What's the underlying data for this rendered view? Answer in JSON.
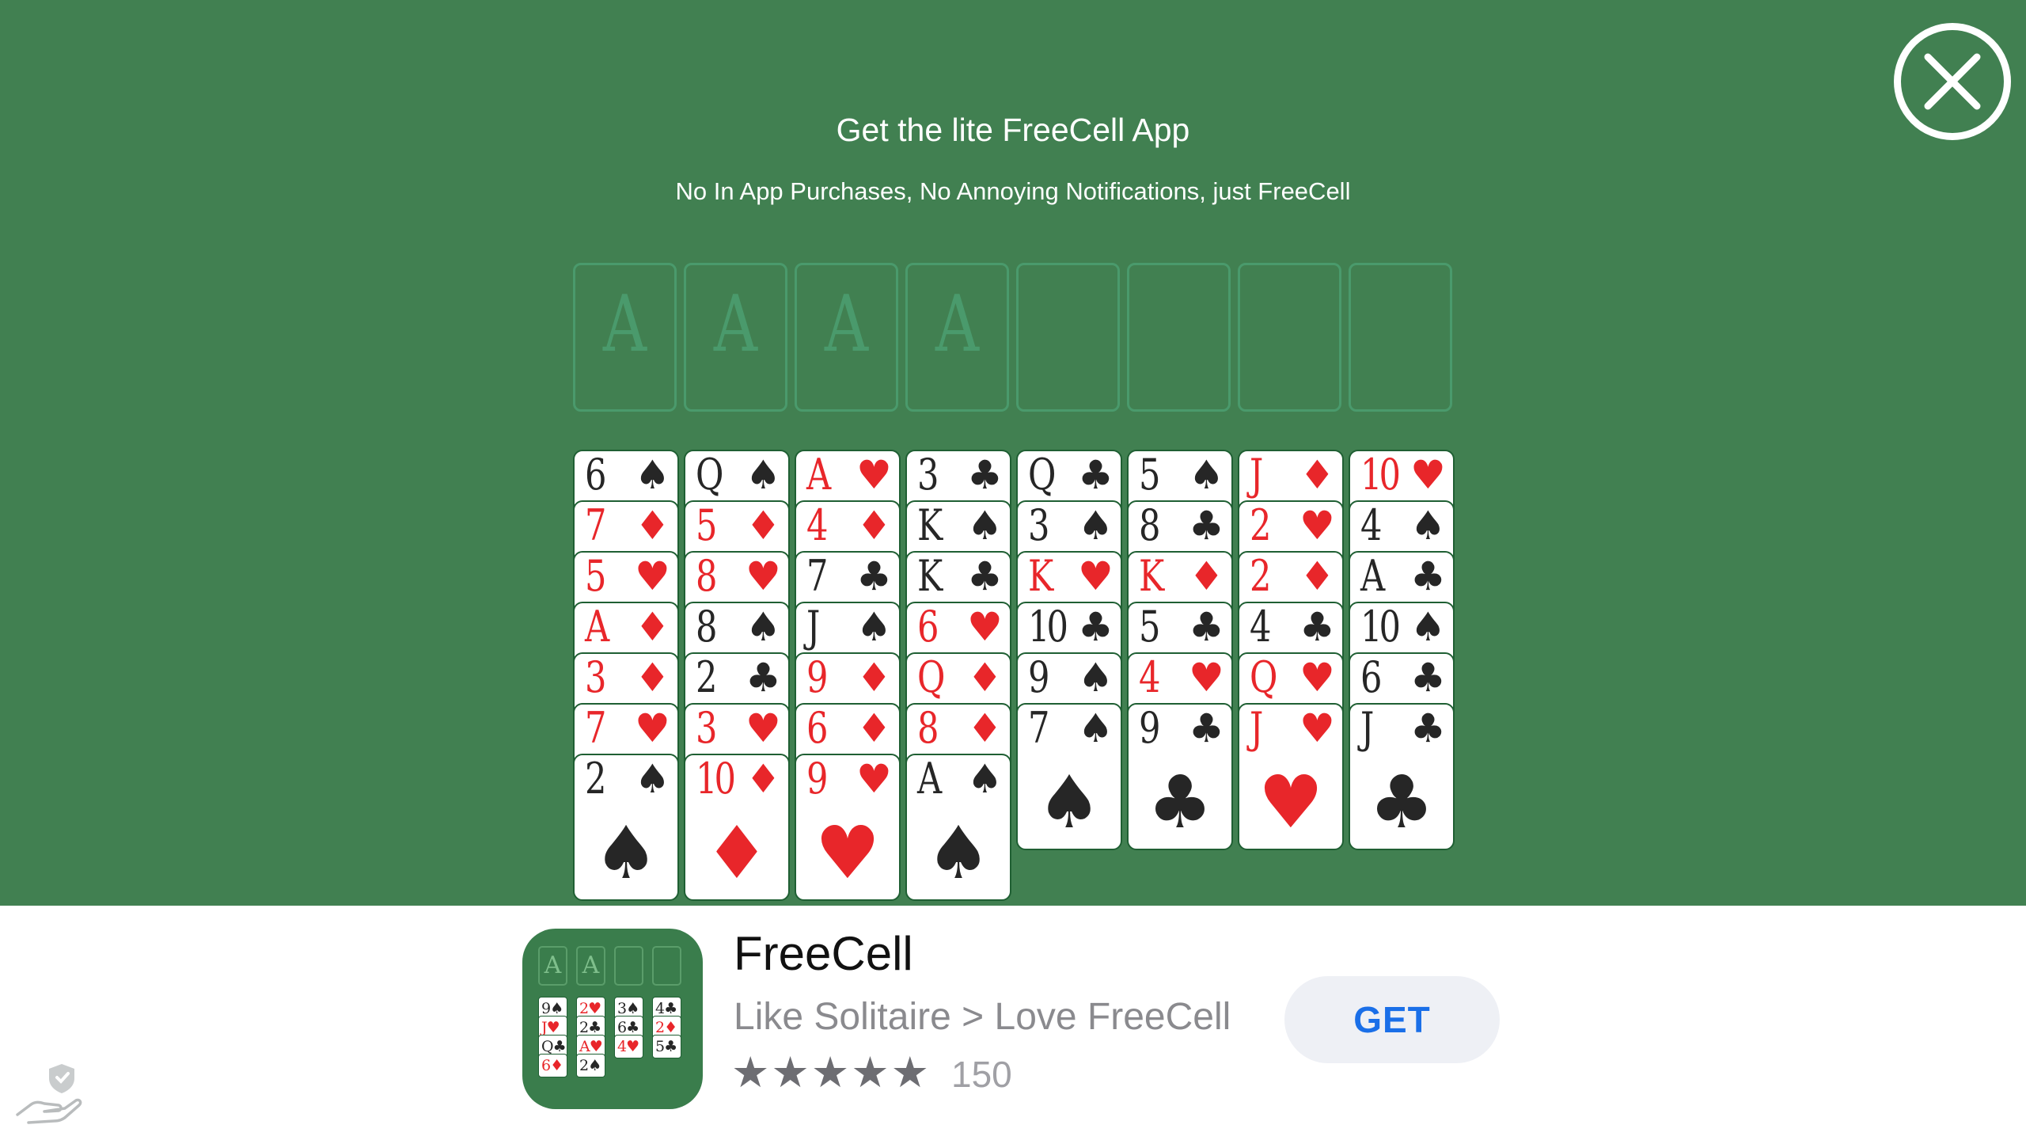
{
  "header": {
    "title": "Get the lite FreeCell App",
    "subtitle": "No In App Purchases, No Annoying Notifications, just FreeCell"
  },
  "foundations": [
    "A",
    "A",
    "A",
    "A",
    "",
    "",
    "",
    ""
  ],
  "tableau": [
    [
      {
        "r": "6",
        "s": "♠",
        "c": "black"
      },
      {
        "r": "7",
        "s": "♦",
        "c": "red"
      },
      {
        "r": "5",
        "s": "♥",
        "c": "red"
      },
      {
        "r": "A",
        "s": "♦",
        "c": "red"
      },
      {
        "r": "3",
        "s": "♦",
        "c": "red"
      },
      {
        "r": "7",
        "s": "♥",
        "c": "red"
      },
      {
        "r": "2",
        "s": "♠",
        "c": "black"
      }
    ],
    [
      {
        "r": "Q",
        "s": "♠",
        "c": "black"
      },
      {
        "r": "5",
        "s": "♦",
        "c": "red"
      },
      {
        "r": "8",
        "s": "♥",
        "c": "red"
      },
      {
        "r": "8",
        "s": "♠",
        "c": "black"
      },
      {
        "r": "2",
        "s": "♣",
        "c": "black"
      },
      {
        "r": "3",
        "s": "♥",
        "c": "red"
      },
      {
        "r": "10",
        "s": "♦",
        "c": "red"
      }
    ],
    [
      {
        "r": "A",
        "s": "♥",
        "c": "red"
      },
      {
        "r": "4",
        "s": "♦",
        "c": "red"
      },
      {
        "r": "7",
        "s": "♣",
        "c": "black"
      },
      {
        "r": "J",
        "s": "♠",
        "c": "black"
      },
      {
        "r": "9",
        "s": "♦",
        "c": "red"
      },
      {
        "r": "6",
        "s": "♦",
        "c": "red"
      },
      {
        "r": "9",
        "s": "♥",
        "c": "red"
      }
    ],
    [
      {
        "r": "3",
        "s": "♣",
        "c": "black"
      },
      {
        "r": "K",
        "s": "♠",
        "c": "black"
      },
      {
        "r": "K",
        "s": "♣",
        "c": "black"
      },
      {
        "r": "6",
        "s": "♥",
        "c": "red"
      },
      {
        "r": "Q",
        "s": "♦",
        "c": "red"
      },
      {
        "r": "8",
        "s": "♦",
        "c": "red"
      },
      {
        "r": "A",
        "s": "♠",
        "c": "black"
      }
    ],
    [
      {
        "r": "Q",
        "s": "♣",
        "c": "black"
      },
      {
        "r": "3",
        "s": "♠",
        "c": "black"
      },
      {
        "r": "K",
        "s": "♥",
        "c": "red"
      },
      {
        "r": "10",
        "s": "♣",
        "c": "black"
      },
      {
        "r": "9",
        "s": "♠",
        "c": "black"
      },
      {
        "r": "7",
        "s": "♠",
        "c": "black"
      }
    ],
    [
      {
        "r": "5",
        "s": "♠",
        "c": "black"
      },
      {
        "r": "8",
        "s": "♣",
        "c": "black"
      },
      {
        "r": "K",
        "s": "♦",
        "c": "red"
      },
      {
        "r": "5",
        "s": "♣",
        "c": "black"
      },
      {
        "r": "4",
        "s": "♥",
        "c": "red"
      },
      {
        "r": "9",
        "s": "♣",
        "c": "black"
      }
    ],
    [
      {
        "r": "J",
        "s": "♦",
        "c": "red"
      },
      {
        "r": "2",
        "s": "♥",
        "c": "red"
      },
      {
        "r": "2",
        "s": "♦",
        "c": "red"
      },
      {
        "r": "4",
        "s": "♣",
        "c": "black"
      },
      {
        "r": "Q",
        "s": "♥",
        "c": "red"
      },
      {
        "r": "J",
        "s": "♥",
        "c": "red"
      }
    ],
    [
      {
        "r": "10",
        "s": "♥",
        "c": "red"
      },
      {
        "r": "4",
        "s": "♠",
        "c": "black"
      },
      {
        "r": "A",
        "s": "♣",
        "c": "black"
      },
      {
        "r": "10",
        "s": "♠",
        "c": "black"
      },
      {
        "r": "6",
        "s": "♣",
        "c": "black"
      },
      {
        "r": "J",
        "s": "♣",
        "c": "black"
      }
    ]
  ],
  "app_banner": {
    "name": "FreeCell",
    "tagline": "Like Solitaire > Love FreeCell",
    "stars": "★★★★★",
    "rating_count": "150",
    "get_label": "GET",
    "icon": {
      "slots": [
        "A",
        "A",
        "",
        ""
      ],
      "cards": [
        [
          {
            "r": "9",
            "s": "♠",
            "c": "black"
          },
          {
            "r": "J",
            "s": "♥",
            "c": "red"
          },
          {
            "r": "Q",
            "s": "♣",
            "c": "black"
          },
          {
            "r": "6",
            "s": "♦",
            "c": "red"
          }
        ],
        [
          {
            "r": "2",
            "s": "♥",
            "c": "red"
          },
          {
            "r": "2",
            "s": "♣",
            "c": "black"
          },
          {
            "r": "A",
            "s": "♥",
            "c": "red"
          },
          {
            "r": "2",
            "s": "♠",
            "c": "black"
          }
        ],
        [
          {
            "r": "3",
            "s": "♠",
            "c": "black"
          },
          {
            "r": "6",
            "s": "♣",
            "c": "black"
          },
          {
            "r": "4",
            "s": "♥",
            "c": "red"
          }
        ],
        [
          {
            "r": "4",
            "s": "♣",
            "c": "black"
          },
          {
            "r": "2",
            "s": "♦",
            "c": "red"
          },
          {
            "r": "5",
            "s": "♣",
            "c": "black"
          }
        ]
      ]
    }
  },
  "colors": {
    "felt": "#418051",
    "red_suit": "#e8262a",
    "black_suit": "#262626",
    "get_button_text": "#1a6fe8"
  },
  "icons": {
    "close": "close-icon",
    "privacy": "privacy-shield-icon"
  }
}
